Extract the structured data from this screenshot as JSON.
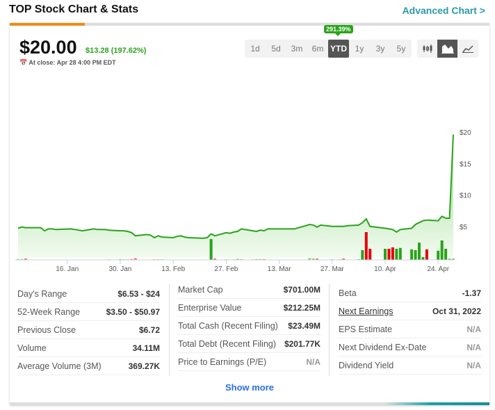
{
  "header": {
    "title": "TOP Stock Chart & Stats",
    "advanced_link": "Advanced Chart >"
  },
  "quote": {
    "price": "$20.00",
    "change": "$13.28 (197.62%)",
    "close_label": "At close: Apr 28 4:00 PM EDT",
    "calendar_icon": "calendar-icon"
  },
  "ranges": {
    "items": [
      "1d",
      "5d",
      "3m",
      "6m",
      "YTD",
      "1y",
      "3y",
      "5y"
    ],
    "active": "YTD",
    "tooltip": "291.39%"
  },
  "chart_types": [
    "candlestick-icon",
    "area-chart-icon",
    "line-chart-icon"
  ],
  "colors": {
    "up": "#2aa31a",
    "down": "#e8000b",
    "accent": "#f08a12",
    "link": "#2a9aa8"
  },
  "chart_data": {
    "type": "area",
    "y_ticks": [
      "$5",
      "$10",
      "$15",
      "$20"
    ],
    "y_tick_values": [
      5,
      10,
      15,
      20
    ],
    "ylim": [
      0,
      20
    ],
    "x_ticks": [
      "16. Jan",
      "30. Jan",
      "13. Feb",
      "27. Feb",
      "13. Mar",
      "27. Mar",
      "10. Apr",
      "24. Apr"
    ],
    "x_tick_dates": [
      "2023-01-16",
      "2023-01-30",
      "2023-02-13",
      "2023-02-27",
      "2023-03-13",
      "2023-03-27",
      "2023-04-10",
      "2023-04-24"
    ],
    "dates": [
      "2023-01-03",
      "2023-01-04",
      "2023-01-05",
      "2023-01-06",
      "2023-01-09",
      "2023-01-10",
      "2023-01-11",
      "2023-01-12",
      "2023-01-13",
      "2023-01-17",
      "2023-01-18",
      "2023-01-19",
      "2023-01-20",
      "2023-01-23",
      "2023-01-24",
      "2023-01-25",
      "2023-01-26",
      "2023-01-27",
      "2023-01-30",
      "2023-01-31",
      "2023-02-01",
      "2023-02-02",
      "2023-02-03",
      "2023-02-06",
      "2023-02-07",
      "2023-02-08",
      "2023-02-09",
      "2023-02-10",
      "2023-02-13",
      "2023-02-14",
      "2023-02-15",
      "2023-02-16",
      "2023-02-17",
      "2023-02-21",
      "2023-02-22",
      "2023-02-23",
      "2023-02-24",
      "2023-02-27",
      "2023-02-28",
      "2023-03-01",
      "2023-03-02",
      "2023-03-03",
      "2023-03-06",
      "2023-03-07",
      "2023-03-08",
      "2023-03-09",
      "2023-03-10",
      "2023-03-13",
      "2023-03-14",
      "2023-03-15",
      "2023-03-16",
      "2023-03-17",
      "2023-03-20",
      "2023-03-21",
      "2023-03-22",
      "2023-03-23",
      "2023-03-24",
      "2023-03-27",
      "2023-03-28",
      "2023-03-29",
      "2023-03-30",
      "2023-03-31",
      "2023-04-03",
      "2023-04-04",
      "2023-04-05",
      "2023-04-06",
      "2023-04-10",
      "2023-04-11",
      "2023-04-12",
      "2023-04-13",
      "2023-04-14",
      "2023-04-17",
      "2023-04-18",
      "2023-04-19",
      "2023-04-20",
      "2023-04-21",
      "2023-04-24",
      "2023-04-25",
      "2023-04-26",
      "2023-04-27",
      "2023-04-28"
    ],
    "prices": [
      4.7,
      4.9,
      4.8,
      4.8,
      4.8,
      4.3,
      4.6,
      4.6,
      4.5,
      4.6,
      4.5,
      4.4,
      4.3,
      4.6,
      4.5,
      4.5,
      4.5,
      4.4,
      4.3,
      4.3,
      4.2,
      4.0,
      3.5,
      3.7,
      3.6,
      3.2,
      3.5,
      3.3,
      3.2,
      3.4,
      3.5,
      3.3,
      3.2,
      3.1,
      3.2,
      3.8,
      3.5,
      4.0,
      3.9,
      4.1,
      4.2,
      4.6,
      4.3,
      4.2,
      4.4,
      4.3,
      4.6,
      4.6,
      4.6,
      4.6,
      4.6,
      4.6,
      5.1,
      5.3,
      5.2,
      4.9,
      5.2,
      5.0,
      5.0,
      5.0,
      5.0,
      5.1,
      5.2,
      5.6,
      6.2,
      5.0,
      4.7,
      4.6,
      4.5,
      4.1,
      4.5,
      4.7,
      5.3,
      5.6,
      5.9,
      6.0,
      5.9,
      6.6,
      6.3,
      6.3,
      19.6
    ],
    "volume_relative": [
      3,
      3,
      5,
      1,
      1,
      1,
      1,
      1,
      1,
      1,
      1,
      1,
      1,
      1,
      1,
      1,
      1,
      2,
      3,
      2,
      2,
      3,
      6,
      1,
      1,
      2,
      2,
      2,
      1,
      1,
      1,
      1,
      1,
      1,
      1,
      75,
      5,
      2,
      1,
      2,
      4,
      3,
      2,
      3,
      3,
      3,
      1,
      1,
      1,
      1,
      1,
      1,
      1,
      6,
      5,
      5,
      1,
      2,
      1,
      2,
      5,
      1,
      3,
      35,
      100,
      40,
      40,
      40,
      45,
      40,
      43,
      38,
      35,
      62,
      10,
      38,
      33,
      70,
      40,
      5,
      5
    ],
    "volume_direction": [
      "u",
      "u",
      "d",
      "d",
      "d",
      "d",
      "u",
      "d",
      "d",
      "d",
      "d",
      "d",
      "d",
      "d",
      "d",
      "d",
      "d",
      "u",
      "u",
      "d",
      "d",
      "d",
      "d",
      "d",
      "d",
      "d",
      "d",
      "d",
      "d",
      "d",
      "d",
      "d",
      "d",
      "d",
      "d",
      "u",
      "d",
      "u",
      "u",
      "u",
      "u",
      "u",
      "u",
      "u",
      "u",
      "d",
      "u",
      "u",
      "u",
      "u",
      "u",
      "u",
      "u",
      "u",
      "u",
      "d",
      "d",
      "u",
      "u",
      "u",
      "d",
      "u",
      "u",
      "u",
      "d",
      "d",
      "u",
      "d",
      "d",
      "u",
      "u",
      "u",
      "u",
      "u",
      "u",
      "d",
      "u",
      "u",
      "u",
      "u",
      "u"
    ]
  },
  "stats": {
    "col1": [
      {
        "label": "Day's Range",
        "value": "$6.53 - $24"
      },
      {
        "label": "52-Week Range",
        "value": "$3.50 - $50.97"
      },
      {
        "label": "Previous Close",
        "value": "$6.72"
      },
      {
        "label": "Volume",
        "value": "34.11M"
      },
      {
        "label": "Average Volume (3M)",
        "value": "369.27K"
      }
    ],
    "col2": [
      {
        "label": "Market Cap",
        "value": "$701.00M"
      },
      {
        "label": "Enterprise Value",
        "value": "$212.25M"
      },
      {
        "label": "Total Cash (Recent Filing)",
        "value": "$23.49M"
      },
      {
        "label": "Total Debt (Recent Filing)",
        "value": "$201.77K"
      },
      {
        "label": "Price to Earnings (P/E)",
        "value": "N/A"
      }
    ],
    "col3": [
      {
        "label": "Beta",
        "value": "-1.37"
      },
      {
        "label": "Next Earnings",
        "value": "Oct 31, 2022"
      },
      {
        "label": "EPS Estimate",
        "value": "N/A"
      },
      {
        "label": "Next Dividend Ex-Date",
        "value": "N/A"
      },
      {
        "label": "Dividend Yield",
        "value": "N/A"
      }
    ],
    "show_more": "Show more"
  }
}
